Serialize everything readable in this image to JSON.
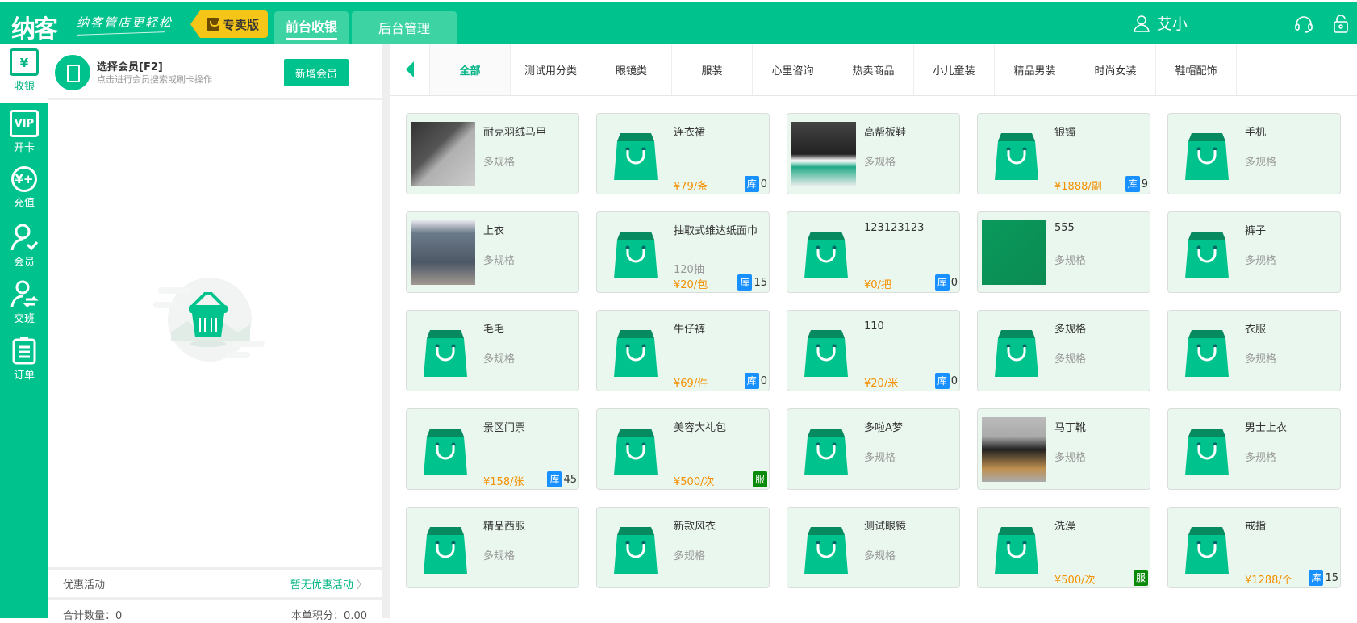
{
  "header": {
    "logo": "纳客",
    "slogan": "纳客管店更轻松",
    "edition_tag": "专卖版",
    "tabs": [
      {
        "label": "前台收银",
        "active": true
      },
      {
        "label": "后台管理",
        "active": false
      }
    ],
    "user": "艾小",
    "brand_color": "#00c28c"
  },
  "sidebar": {
    "items": [
      {
        "label": "收银",
        "icon": "¥",
        "active": true
      },
      {
        "label": "开卡",
        "icon": "VIP"
      },
      {
        "label": "充值",
        "icon": "¥+"
      },
      {
        "label": "会员",
        "icon": "person-check"
      },
      {
        "label": "交班",
        "icon": "person-swap"
      },
      {
        "label": "订单",
        "icon": "clipboard"
      }
    ]
  },
  "member": {
    "title": "选择会员[F2]",
    "subtitle": "点击进行会员搜索或刷卡操作",
    "add_button": "新增会员"
  },
  "promo": {
    "label": "优惠活动",
    "value": "暂无优惠活动"
  },
  "summary": {
    "count": "合计数量：0",
    "points": "本单积分：0.00"
  },
  "categories": [
    "全部",
    "测试用分类",
    "眼镜类",
    "服装",
    "心里咨询",
    "热卖商品",
    "小儿童装",
    "精品男装",
    "时尚女装",
    "鞋帽配饰"
  ],
  "products": [
    {
      "name": "耐克羽绒马甲",
      "spec": "多规格",
      "image": "jacket"
    },
    {
      "name": "连衣裙",
      "price": "¥79/条",
      "stock_label": "库",
      "stock": "0"
    },
    {
      "name": "高帮板鞋",
      "spec": "多规格",
      "image": "shoe"
    },
    {
      "name": "银镯",
      "price": "¥1888/副",
      "stock_label": "库",
      "stock": "9"
    },
    {
      "name": "手机",
      "spec": "多规格"
    },
    {
      "name": "上衣",
      "spec": "多规格",
      "image": "building"
    },
    {
      "name": "抽取式维达纸面巾",
      "spec2": "120抽",
      "price": "¥20/包",
      "stock_label": "库",
      "stock": "15"
    },
    {
      "name": "123123123",
      "price": "¥0/把",
      "stock_label": "库",
      "stock": "0"
    },
    {
      "name": "555",
      "spec": "多规格",
      "image": "app"
    },
    {
      "name": "裤子",
      "spec": "多规格"
    },
    {
      "name": "毛毛",
      "spec": "多规格"
    },
    {
      "name": "牛仔裤",
      "price": "¥69/件",
      "stock_label": "库",
      "stock": "0"
    },
    {
      "name": "110",
      "price": "¥20/米",
      "stock_label": "库",
      "stock": "0"
    },
    {
      "name": "多规格",
      "spec": "多规格"
    },
    {
      "name": "衣服",
      "spec": "多规格"
    },
    {
      "name": "景区门票",
      "price": "¥158/张",
      "stock_label": "库",
      "stock": "45"
    },
    {
      "name": "美容大礼包",
      "price": "¥500/次",
      "service_label": "服"
    },
    {
      "name": "多啦A梦",
      "spec": "多规格"
    },
    {
      "name": "马丁靴",
      "spec": "多规格",
      "image": "boot"
    },
    {
      "name": "男士上衣",
      "spec": "多规格"
    },
    {
      "name": "精品西服",
      "spec": "多规格"
    },
    {
      "name": "新款风衣",
      "spec": "多规格"
    },
    {
      "name": "测试眼镜",
      "spec": "多规格"
    },
    {
      "name": "洗澡",
      "price": "¥500/次",
      "service_label": "服"
    },
    {
      "name": "戒指",
      "price": "¥1288/个",
      "stock_label": "库",
      "stock": "15"
    }
  ]
}
